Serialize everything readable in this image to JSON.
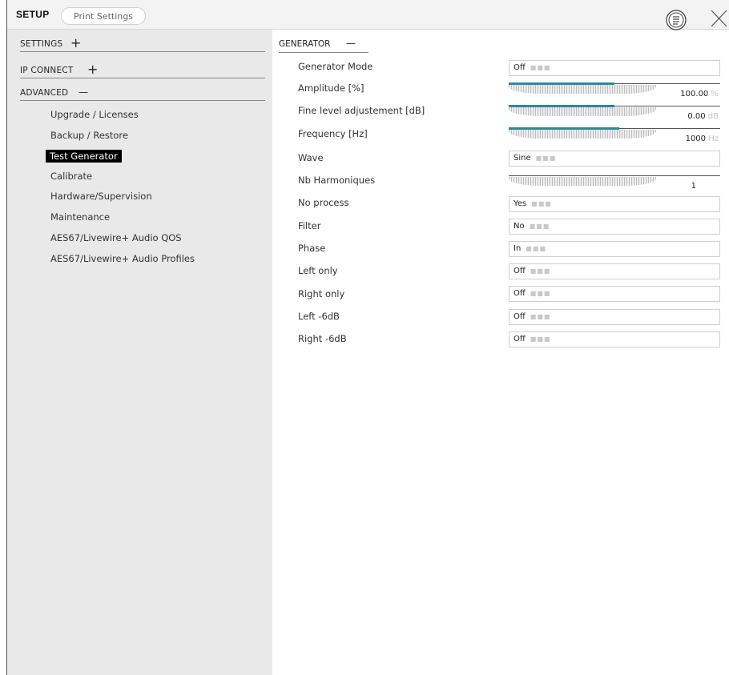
{
  "header": {
    "title": "SETUP",
    "tab_label": "Print Settings",
    "menu_icon": "list-circle-icon",
    "close_icon": "close-icon"
  },
  "sidebar": {
    "sections": [
      {
        "label": "SETTINGS",
        "sign": "+"
      },
      {
        "label": "IP CONNECT",
        "sign": "+"
      },
      {
        "label": "ADVANCED",
        "sign": "—"
      }
    ],
    "advanced_items": [
      {
        "label": "Upgrade / Licenses",
        "active": false
      },
      {
        "label": "Backup / Restore",
        "active": false
      },
      {
        "label": "Test Generator",
        "active": true
      },
      {
        "label": "Calibrate",
        "active": false
      },
      {
        "label": "Hardware/Supervision",
        "active": false
      },
      {
        "label": "Maintenance",
        "active": false
      },
      {
        "label": "AES67/Livewire+ Audio QOS",
        "active": false
      },
      {
        "label": "AES67/Livewire+ Audio Profiles",
        "active": false
      }
    ]
  },
  "generator": {
    "title": "GENERATOR",
    "sign": "—",
    "params": [
      {
        "label": "Generator Mode",
        "type": "select",
        "value": "Off"
      },
      {
        "label": "Amplitude [%]",
        "type": "slider",
        "value": "100.00",
        "unit": "%",
        "fill": 0.5
      },
      {
        "label": "Fine level adjustement [dB]",
        "type": "slider",
        "value": "0.00",
        "unit": "dB",
        "fill": 0.5
      },
      {
        "label": "Frequency [Hz]",
        "type": "slider",
        "value": "1000",
        "unit": "Hz",
        "fill": 0.52
      },
      {
        "label": "Wave",
        "type": "select",
        "value": "Sine"
      },
      {
        "label": "Nb Harmoniques",
        "type": "slider",
        "value": "1",
        "unit": "",
        "fill": 0
      },
      {
        "label": "No process",
        "type": "select",
        "value": "Yes"
      },
      {
        "label": "Filter",
        "type": "select",
        "value": "No"
      },
      {
        "label": "Phase",
        "type": "select",
        "value": "In"
      },
      {
        "label": "Left only",
        "type": "select",
        "value": "Off"
      },
      {
        "label": "Right only",
        "type": "select",
        "value": "Off"
      },
      {
        "label": "Left -6dB",
        "type": "select",
        "value": "Off"
      },
      {
        "label": "Right -6dB",
        "type": "select",
        "value": "Off"
      }
    ]
  },
  "colors": {
    "accent": "#2a8a9a",
    "sidebar_bg": "#e9e9e9",
    "active_bg": "#000000"
  }
}
